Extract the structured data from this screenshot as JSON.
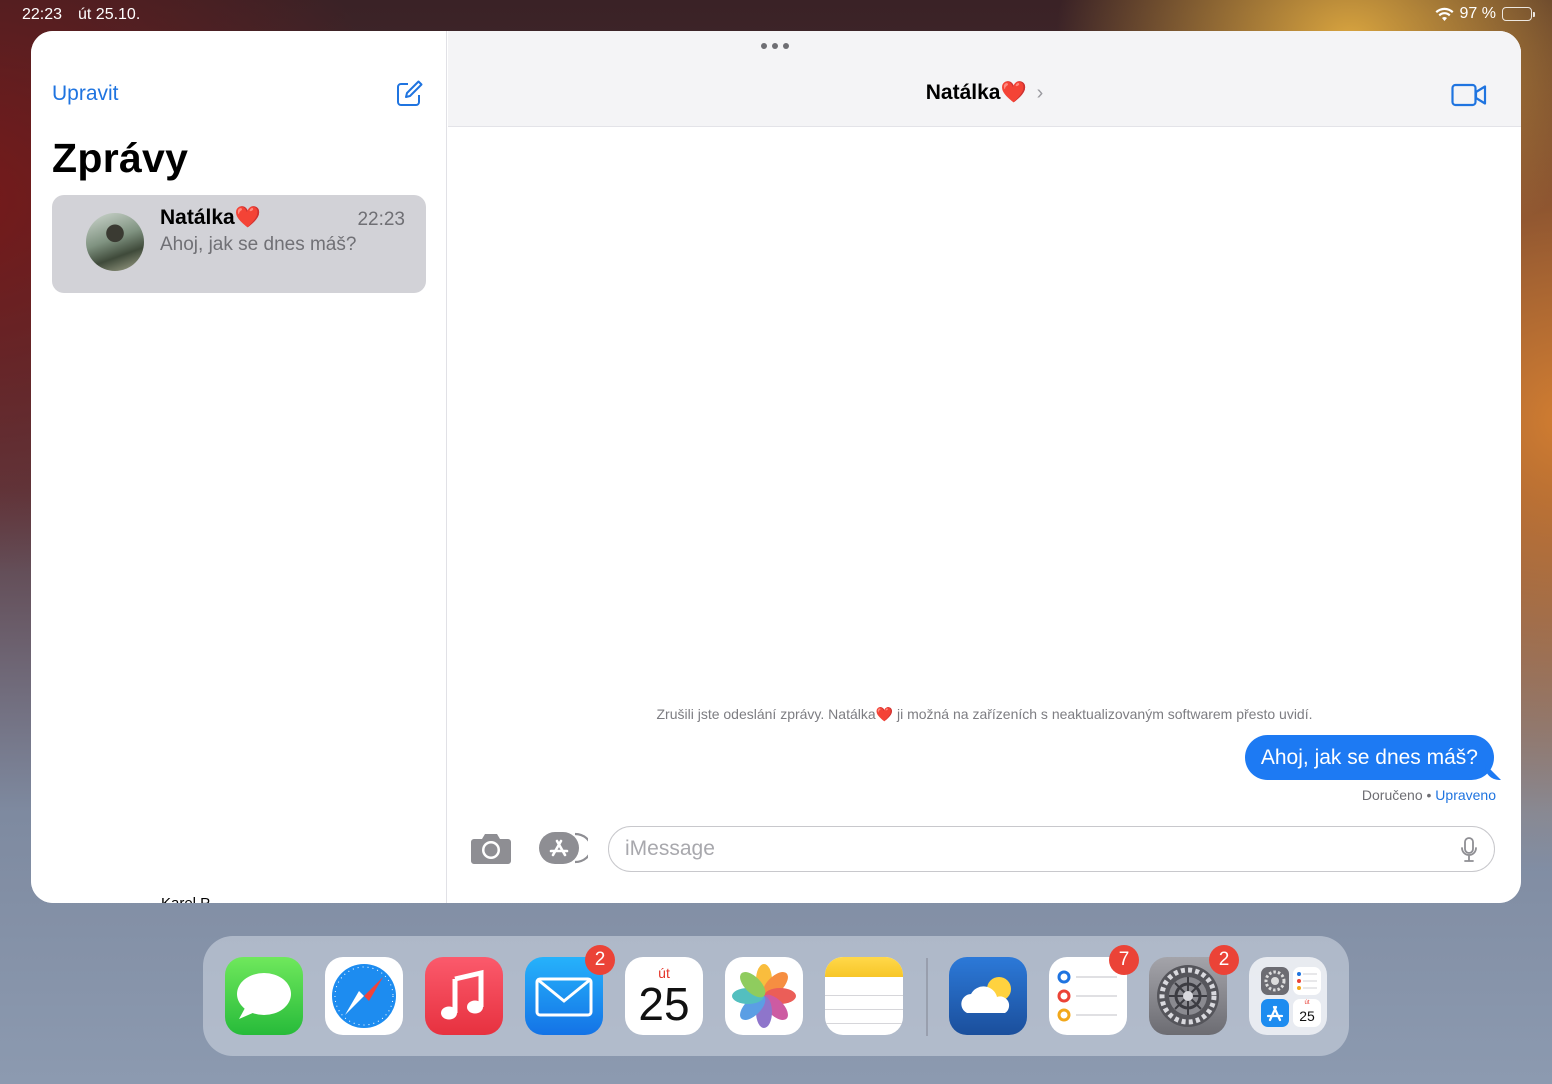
{
  "status_bar": {
    "time": "22:23",
    "date": "út 25.10.",
    "battery_text": "97 %"
  },
  "sidebar": {
    "edit_label": "Upravit",
    "title": "Zprávy",
    "conversations": [
      {
        "name": "Natálka❤️",
        "time": "22:23",
        "preview": "Ahoj, jak se dnes máš?"
      }
    ],
    "partial_text": "Karel P..."
  },
  "chat": {
    "title": "Natálka❤️",
    "system_note": "Zrušili jste odeslání zprávy. Natálka❤️ ji možná na zařízeních s neaktualizovaným softwarem přesto uvidí.",
    "message": "Ahoj, jak se dnes máš?",
    "receipt_status": "Doručeno",
    "receipt_separator": "•",
    "receipt_edited": "Upraveno",
    "input_placeholder": "iMessage"
  },
  "dock": {
    "apps": [
      {
        "name": "Zprávy",
        "icon": "messages-icon"
      },
      {
        "name": "Safari",
        "icon": "safari-icon"
      },
      {
        "name": "Hudba",
        "icon": "music-icon"
      },
      {
        "name": "Mail",
        "icon": "mail-icon",
        "badge": "2"
      },
      {
        "name": "Kalendář",
        "icon": "calendar-icon",
        "weekday": "út",
        "day": "25"
      },
      {
        "name": "Fotky",
        "icon": "photos-icon"
      },
      {
        "name": "Poznámky",
        "icon": "notes-icon"
      },
      {
        "name": "Počasí",
        "icon": "weather-icon"
      },
      {
        "name": "Připomínky",
        "icon": "reminders-icon",
        "badge": "7"
      },
      {
        "name": "Nastavení",
        "icon": "settings-icon",
        "badge": "2"
      },
      {
        "name": "Knihovna aplikací",
        "icon": "app-library-icon",
        "day": "25",
        "weekday": "út"
      }
    ]
  },
  "colors": {
    "accent": "#1f74e0",
    "bubble": "#1d7af3",
    "badge": "#eb4337"
  }
}
